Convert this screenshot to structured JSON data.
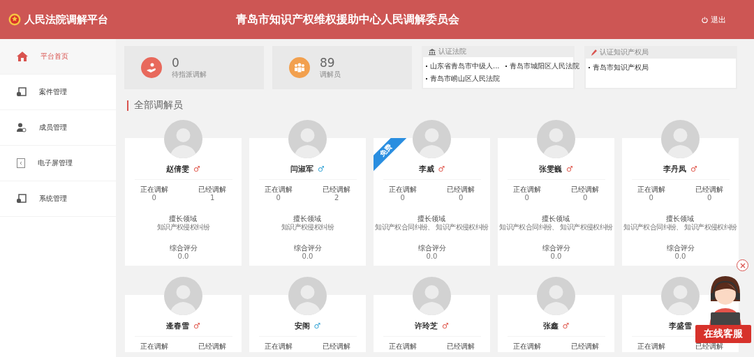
{
  "header": {
    "brand": "人民法院调解平台",
    "title": "青岛市知识产权维权援助中心人民调解委员会",
    "logout": "退出"
  },
  "sidebar": {
    "items": [
      {
        "label": "平台首页",
        "kind": "home",
        "selected": true
      },
      {
        "label": "案件管理",
        "kind": "case",
        "selected": false
      },
      {
        "label": "成员管理",
        "kind": "member",
        "selected": false
      },
      {
        "label": "电子屏管理",
        "kind": "screen",
        "selected": false
      },
      {
        "label": "系统管理",
        "kind": "case",
        "selected": false
      }
    ]
  },
  "stats": [
    {
      "value": "0",
      "label": "待指派调解",
      "kind": "hand",
      "color": "#e8695c"
    },
    {
      "value": "89",
      "label": "调解员",
      "kind": "group",
      "color": "#f2a04e"
    }
  ],
  "certified": [
    {
      "title": "认证法院",
      "kind": "bank",
      "items": [
        "山东省青岛市中级人...",
        "青岛市城阳区人民法院",
        "青岛市崂山区人民法院"
      ]
    },
    {
      "title": "认证知识产权局",
      "kind": "pen",
      "items": [
        "青岛市知识产权局"
      ]
    }
  ],
  "section_title": "全部调解员",
  "mediators": [
    {
      "name": "赵倩雯",
      "gender": "♂",
      "color": "#e05a4f",
      "stats": [
        {
          "label": "正在调解",
          "value": "0"
        },
        {
          "label": "已经调解",
          "value": "1"
        }
      ],
      "specialty_label": "擅长领域",
      "specialty": "知识产权侵权纠纷",
      "rating_label": "综合评分",
      "rating": "0.0"
    },
    {
      "name": "闫淑军",
      "gender": "♂",
      "color": "#3aa6d6",
      "stats": [
        {
          "label": "正在调解",
          "value": "0"
        },
        {
          "label": "已经调解",
          "value": "2"
        }
      ],
      "specialty_label": "擅长领域",
      "specialty": "知识产权侵权纠纷",
      "rating_label": "综合评分",
      "rating": "0.0"
    },
    {
      "name": "李威",
      "gender": "♂",
      "color": "#e05a4f",
      "badge": "免费",
      "stats": [
        {
          "label": "正在调解",
          "value": "0"
        },
        {
          "label": "已经调解",
          "value": "0"
        }
      ],
      "specialty_label": "擅长领域",
      "specialty": "知识产权合同纠纷、 知识产权侵权纠纷",
      "rating_label": "综合评分",
      "rating": "0.0"
    },
    {
      "name": "张雯巍",
      "gender": "♂",
      "color": "#e05a4f",
      "stats": [
        {
          "label": "正在调解",
          "value": "0"
        },
        {
          "label": "已经调解",
          "value": "0"
        }
      ],
      "specialty_label": "擅长领域",
      "specialty": "知识产权合同纠纷、 知识产权侵权纠纷",
      "rating_label": "综合评分",
      "rating": "0.0"
    },
    {
      "name": "李丹凤",
      "gender": "♂",
      "color": "#e05a4f",
      "stats": [
        {
          "label": "正在调解",
          "value": "0"
        },
        {
          "label": "已经调解",
          "value": "0"
        }
      ],
      "specialty_label": "擅长领域",
      "specialty": "知识产权合同纠纷、 知识产权侵权纠纷",
      "rating_label": "综合评分",
      "rating": "0.0"
    },
    {
      "name": "逄春雪",
      "gender": "♂",
      "color": "#e05a4f",
      "stats": [
        {
          "label": "正在调解"
        },
        {
          "label": "已经调解"
        }
      ]
    },
    {
      "name": "安阁",
      "gender": "♂",
      "color": "#3aa6d6",
      "stats": [
        {
          "label": "正在调解"
        },
        {
          "label": "已经调解"
        }
      ]
    },
    {
      "name": "许玲芝",
      "gender": "♂",
      "color": "#e05a4f",
      "stats": [
        {
          "label": "正在调解"
        },
        {
          "label": "已经调解"
        }
      ]
    },
    {
      "name": "张鑫",
      "gender": "♂",
      "color": "#e05a4f",
      "stats": [
        {
          "label": "正在调解"
        },
        {
          "label": "已经调解"
        }
      ]
    },
    {
      "name": "李盛雪",
      "stats": [
        {
          "label": "正在调解"
        },
        {
          "label": "已经调解"
        }
      ]
    }
  ],
  "service_widget": {
    "label": "在线客服"
  }
}
